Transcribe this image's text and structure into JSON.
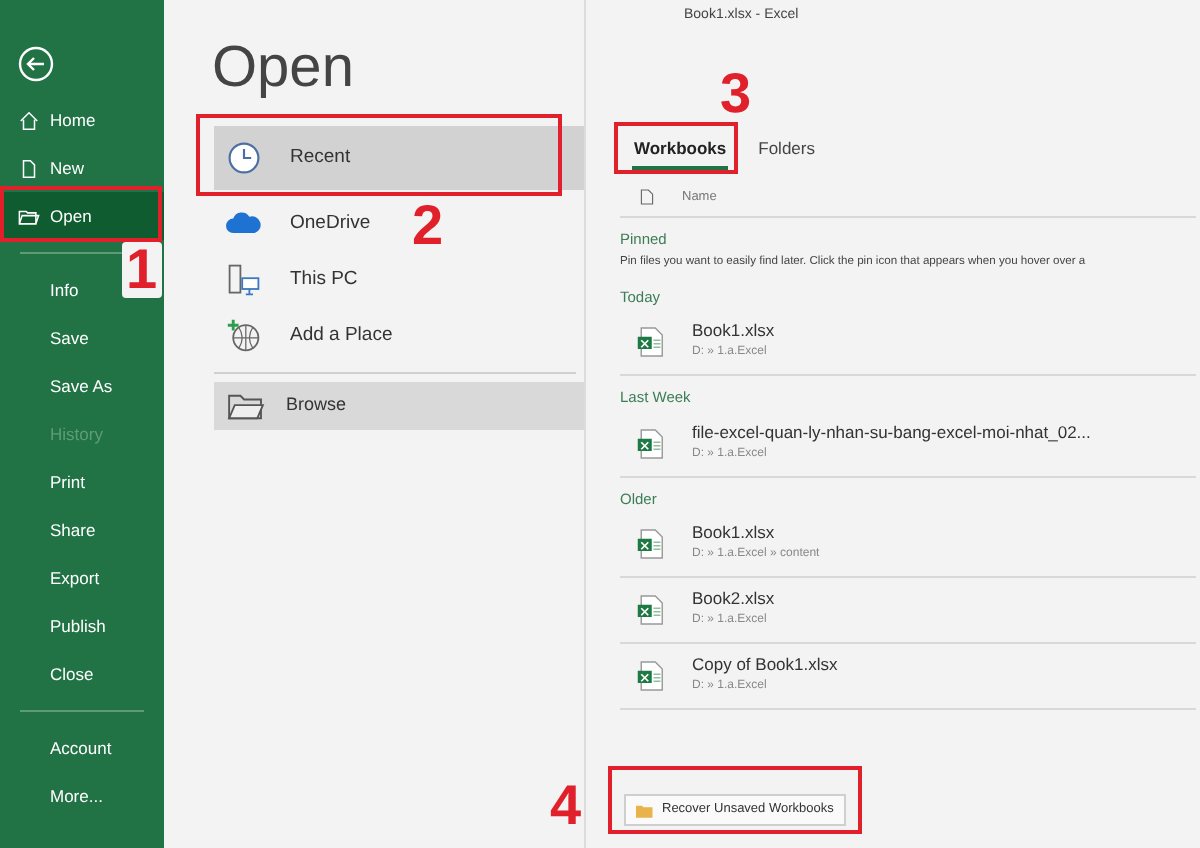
{
  "window": {
    "title": "Book1.xlsx  -  Excel"
  },
  "sidebar": {
    "groups": [
      [
        {
          "label": "Home",
          "selected": false,
          "disabled": false
        },
        {
          "label": "New",
          "selected": false,
          "disabled": false
        },
        {
          "label": "Open",
          "selected": true,
          "disabled": false
        }
      ],
      [
        {
          "label": "Info",
          "selected": false,
          "disabled": false
        },
        {
          "label": "Save",
          "selected": false,
          "disabled": false
        },
        {
          "label": "Save As",
          "selected": false,
          "disabled": false
        },
        {
          "label": "History",
          "selected": false,
          "disabled": true
        },
        {
          "label": "Print",
          "selected": false,
          "disabled": false
        },
        {
          "label": "Share",
          "selected": false,
          "disabled": false
        },
        {
          "label": "Export",
          "selected": false,
          "disabled": false
        },
        {
          "label": "Publish",
          "selected": false,
          "disabled": false
        },
        {
          "label": "Close",
          "selected": false,
          "disabled": false
        }
      ],
      [
        {
          "label": "Account",
          "selected": false,
          "disabled": false
        },
        {
          "label": "More...",
          "selected": false,
          "disabled": false
        }
      ]
    ]
  },
  "page_title": "Open",
  "locations": [
    {
      "label": "Recent",
      "selected": true
    },
    {
      "label": "OneDrive",
      "selected": false
    },
    {
      "label": "This PC",
      "selected": false
    },
    {
      "label": "Add a Place",
      "selected": false
    }
  ],
  "browse_button": {
    "label": "Browse"
  },
  "tabs": [
    {
      "label": "Workbooks",
      "selected": true
    },
    {
      "label": "Folders",
      "selected": false
    }
  ],
  "column_header": "Name",
  "sections": [
    {
      "heading": "Pinned",
      "note": "Pin files you want to easily find later. Click the pin icon that appears when you hover over a"
    },
    {
      "heading": "Today",
      "files": [
        {
          "name": "Book1.xlsx",
          "path": "D: » 1.a.Excel"
        }
      ]
    },
    {
      "heading": "Last Week",
      "files": [
        {
          "name": "file-excel-quan-ly-nhan-su-bang-excel-moi-nhat_02...",
          "path": "D: » 1.a.Excel"
        }
      ]
    },
    {
      "heading": "Older",
      "files": [
        {
          "name": "Book1.xlsx",
          "path": "D: » 1.a.Excel » content"
        },
        {
          "name": "Book2.xlsx",
          "path": "D: » 1.a.Excel"
        },
        {
          "name": "Copy of Book1.xlsx",
          "path": "D: » 1.a.Excel"
        }
      ]
    }
  ],
  "recover_button": {
    "label": "Recover Unsaved Workbooks"
  },
  "annotations": [
    {
      "label": "1"
    },
    {
      "label": "2"
    },
    {
      "label": "3"
    },
    {
      "label": "4"
    }
  ]
}
